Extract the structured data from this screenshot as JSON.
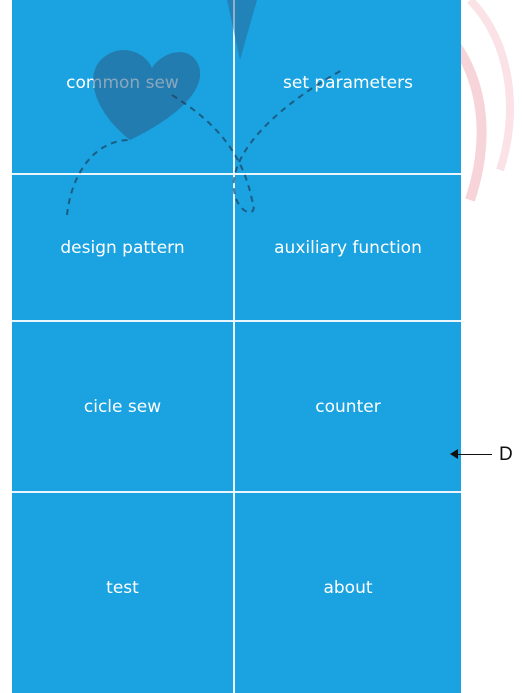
{
  "menu": {
    "items": [
      {
        "label": "common sew"
      },
      {
        "label": "set parameters"
      },
      {
        "label": "design pattern"
      },
      {
        "label": "auxiliary function"
      },
      {
        "label": "cicle sew"
      },
      {
        "label": "counter"
      },
      {
        "label": "test"
      },
      {
        "label": "about"
      }
    ]
  },
  "callout": {
    "label": "D"
  },
  "colors": {
    "panel_background": "#1aa3e0",
    "divider": "#e9f6fd",
    "text": "#ffffff"
  }
}
